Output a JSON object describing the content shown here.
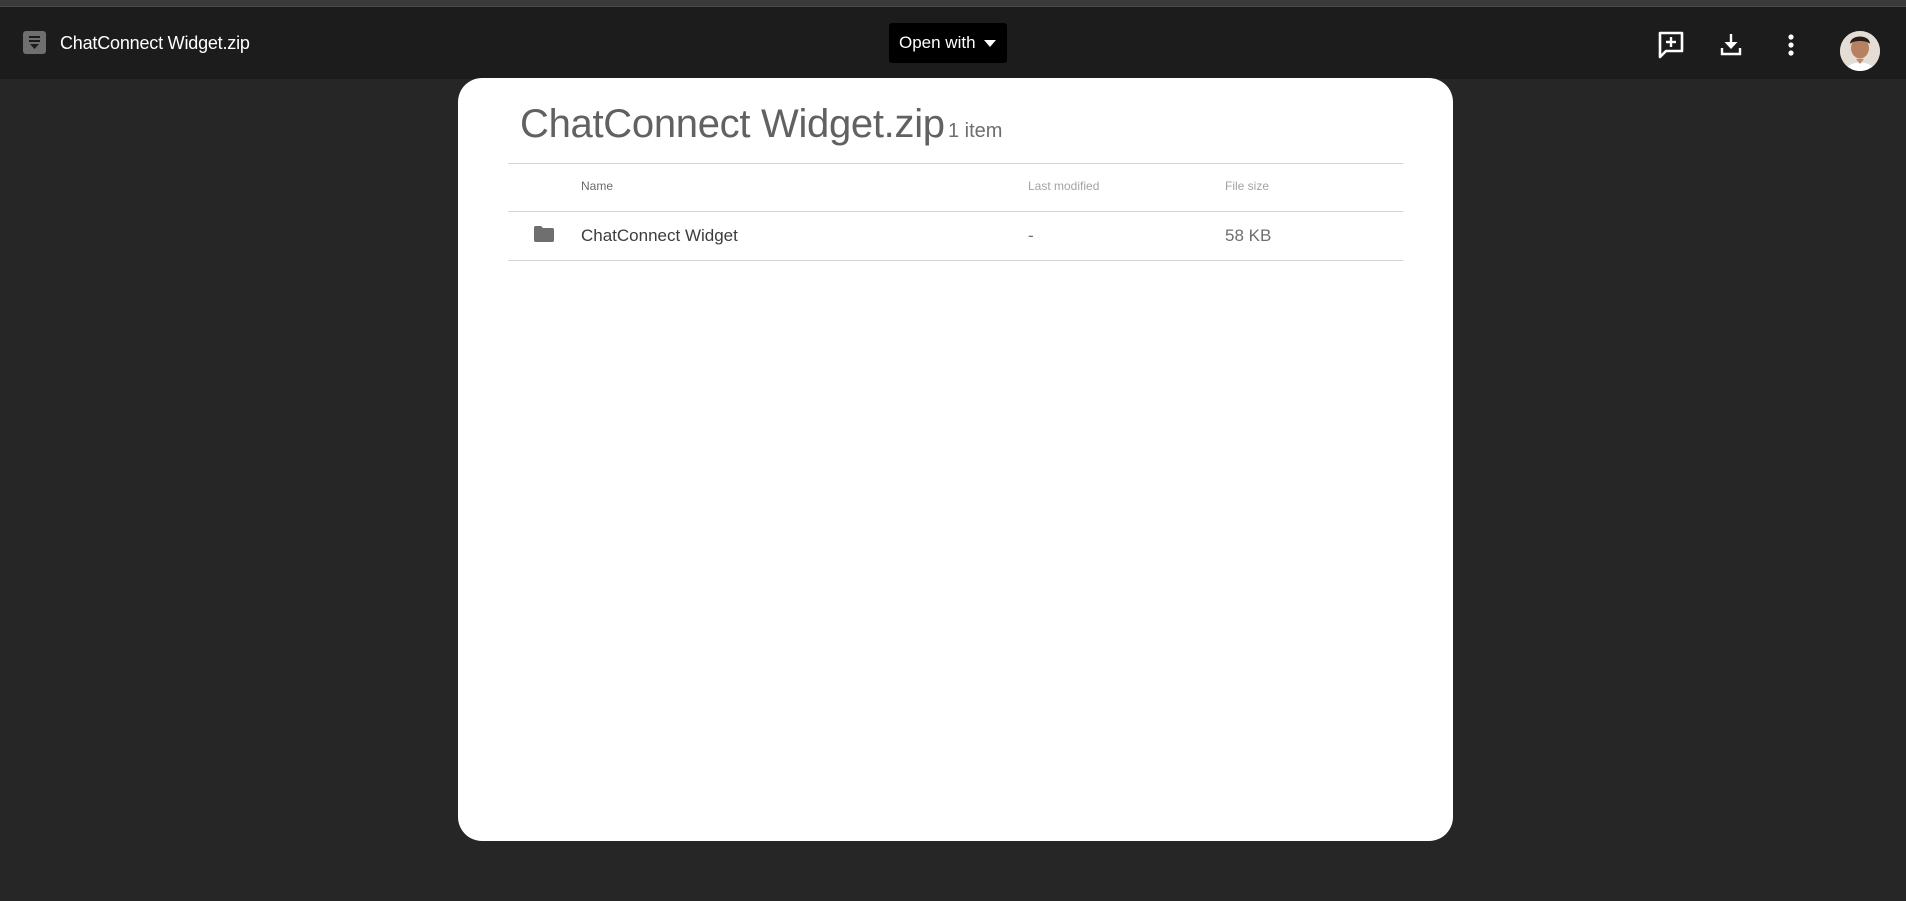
{
  "header": {
    "file_title": "ChatConnect Widget.zip",
    "open_with_label": "Open with",
    "icons": {
      "file_type": "zip-file-icon",
      "add_comment": "add-comment-icon",
      "download": "download-icon",
      "more": "more-vert-icon",
      "avatar": "user-avatar"
    }
  },
  "archive": {
    "title": "ChatConnect Widget.zip",
    "item_count": "1 item",
    "columns": {
      "name": "Name",
      "last_modified": "Last modified",
      "file_size": "File size"
    },
    "rows": [
      {
        "icon": "folder-icon",
        "name": "ChatConnect Widget",
        "last_modified": "-",
        "file_size": "58 KB"
      }
    ]
  },
  "colors": {
    "page_background": "#262626",
    "topbar_background": "#1c1c1c",
    "card_background": "#ffffff",
    "button_background": "#000000"
  }
}
